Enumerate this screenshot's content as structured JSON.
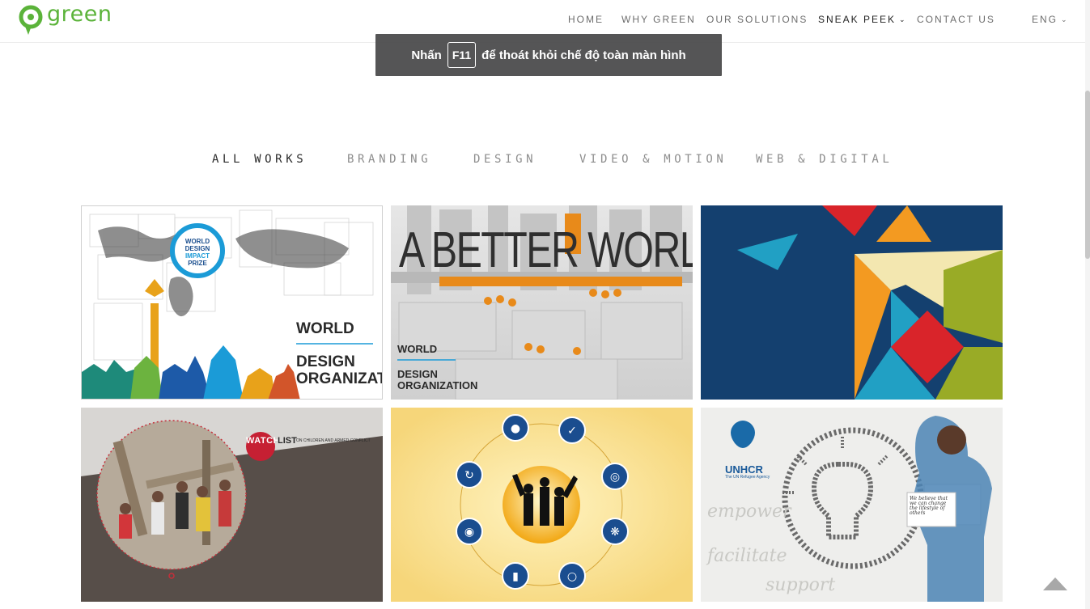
{
  "brand": {
    "name": "green",
    "color": "#5bb33a"
  },
  "nav": {
    "items": [
      {
        "label": "HOME"
      },
      {
        "label": "WHY GREEN"
      },
      {
        "label": "OUR SOLUTIONS"
      },
      {
        "label": "SNEAK PEEK"
      },
      {
        "label": "CONTACT US"
      },
      {
        "label": "ENG"
      }
    ]
  },
  "toast": {
    "before": "Nhấn",
    "key": "F11",
    "after": "để thoát khỏi chế độ toàn màn hình"
  },
  "filters": [
    {
      "label": "ALL WORKS"
    },
    {
      "label": "BRANDING"
    },
    {
      "label": "DESIGN"
    },
    {
      "label": "VIDEO & MOTION"
    },
    {
      "label": "WEB & DIGITAL"
    }
  ],
  "tiles": [
    {
      "badge": [
        "WORLD",
        "DESIGN",
        "IMPACT",
        "PRIZE"
      ],
      "title1": "WORLD",
      "title2": "DESIGN",
      "title3": "ORGANIZATION"
    },
    {
      "headline": "A BETTER WORLD.",
      "title1": "WORLD",
      "title2": "DESIGN",
      "title3": "ORGANIZATION"
    },
    {},
    {
      "watch": "WATCH",
      "list": "LIST",
      "subtitle": "ON CHILDREN AND ARMED CONFLICT"
    },
    {},
    {
      "org": "UNHCR",
      "org_sub": "The UN Refugee Agency",
      "sign": "We believe that we can change the lifestyle of others",
      "word1": "empower",
      "word2": "facilitate",
      "word3": "support"
    }
  ],
  "colors": {
    "accent": "#5bb33a",
    "text": "#6d6d6d",
    "toast_bg": "#464648"
  }
}
